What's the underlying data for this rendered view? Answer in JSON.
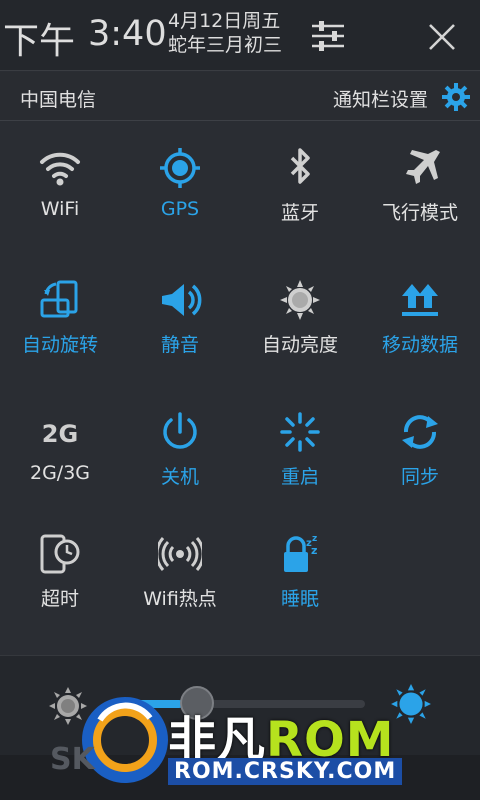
{
  "header": {
    "ampm": "下午",
    "time": "3:40",
    "date_line1": "4月12日周五",
    "date_line2": "蛇年三月初三"
  },
  "carrier": "中国电信",
  "notif_settings_label": "通知栏设置",
  "tiles": [
    {
      "label": "WiFi",
      "icon": "wifi-icon",
      "active": false
    },
    {
      "label": "GPS",
      "icon": "gps-icon",
      "active": true
    },
    {
      "label": "蓝牙",
      "icon": "bluetooth-icon",
      "active": false
    },
    {
      "label": "飞行模式",
      "icon": "airplane-icon",
      "active": false
    },
    {
      "label": "自动旋转",
      "icon": "rotate-icon",
      "active": true
    },
    {
      "label": "静音",
      "icon": "speaker-icon",
      "active": true
    },
    {
      "label": "自动亮度",
      "icon": "brightness-icon",
      "active": false
    },
    {
      "label": "移动数据",
      "icon": "mobile-data-icon",
      "active": true
    },
    {
      "label": "2G/3G",
      "icon": "network-2g-icon",
      "active": false
    },
    {
      "label": "关机",
      "icon": "power-icon",
      "active": true
    },
    {
      "label": "重启",
      "icon": "reboot-icon",
      "active": true
    },
    {
      "label": "同步",
      "icon": "sync-icon",
      "active": true
    },
    {
      "label": "超时",
      "icon": "timeout-icon",
      "active": false
    },
    {
      "label": "Wifi热点",
      "icon": "hotspot-icon",
      "active": false
    },
    {
      "label": "睡眠",
      "icon": "sleep-icon",
      "active": true
    }
  ],
  "brightness": {
    "level": 0.27
  },
  "watermark": {
    "brand": "非凡",
    "rom": "ROM",
    "site": "ROM.CRSKY.COM",
    "sk": "SK"
  },
  "colors": {
    "accent": "#2ba3e8",
    "inactive": "#cfcfcf",
    "background": "#2a2d33"
  }
}
